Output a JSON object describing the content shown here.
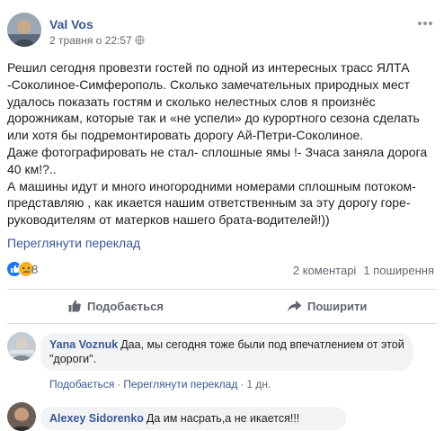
{
  "post": {
    "author": "Val Vos",
    "timestamp": "2 травня о 22:57",
    "paragraphs": [
      "Решил сегодня провезти гостей по одной из интересных трасс ЯЛТА -Соколиное-Симферополь. Сколько замечательных природных мест удалось показать гостям и сколько нелестных слов я произнёс дорожникам, которые так и «не успели» до курортного сезона сделать или хотя бы подремонтировать дорогу Ай-Петри-Соколиное.",
      "Даже фотографировать не стал- сплошные ямы !- Зчаса заняла дорога 40 км!?..",
      "А машины идут и много иногородними номерами сплошным потоком- представляю , как икается нашим ответственным за эту дорогу горе-руководителям от матерков нашего брата-водителей!))"
    ],
    "translate_link": "Переглянути переклад",
    "reactions_count": "8",
    "comments_count": "2 коментарі",
    "shares_count": "1 поширення"
  },
  "actions": {
    "like": "Подобається",
    "share": "Поширити"
  },
  "comments": [
    {
      "author": "Yana Voznuk",
      "text": "Даа, мы сегодня тоже были под впечатлением от этой \"дороги\".",
      "like_link": "Подобається",
      "translate_link": "Переглянути переклад",
      "age": "1 дн."
    },
    {
      "author": "Alexey Sidorenko",
      "text": "Да им насрать,а не икается!!!"
    }
  ],
  "colors": {
    "link": "#385898",
    "meta": "#616770",
    "bubble": "#f2f3f5",
    "like_blue": "#1877f2",
    "sad_yellow": "#f7b125"
  },
  "icons": [
    "globe-icon",
    "more-options-icon",
    "like-reaction-icon",
    "sad-reaction-icon",
    "thumbs-up-icon",
    "share-arrow-icon"
  ]
}
